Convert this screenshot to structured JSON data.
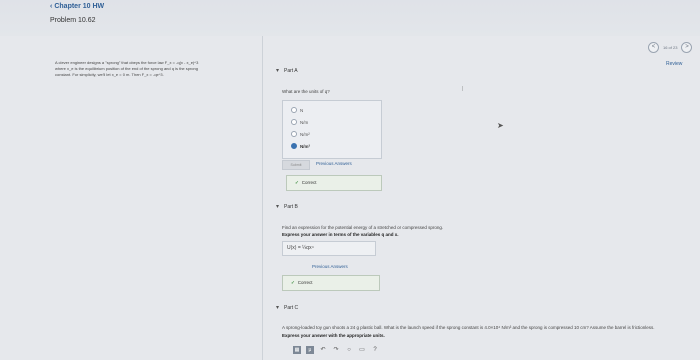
{
  "header": {
    "breadcrumb": "Chapter 10 HW",
    "problem_title": "Problem 10.62"
  },
  "problem": {
    "lines": [
      "A clever engineer designs a \"sprong\" that obeys the force law F_x = -q(x - x_e)^3",
      "where x_e is the equilibrium position of the end of the sprong and q is the sprong",
      "constant. For simplicity, we'll let x_e = 0 m. Then F_x = -qx^3."
    ]
  },
  "pager": {
    "prev": "<",
    "text": "16 of 23",
    "next": ">",
    "review": "Review"
  },
  "part_a": {
    "label": "Part A",
    "question": "What are the units of q?",
    "options": [
      {
        "label": "N",
        "selected": false
      },
      {
        "label": "N/m",
        "selected": false
      },
      {
        "label": "N/m²",
        "selected": false
      },
      {
        "label": "N/m³",
        "selected": true
      }
    ],
    "submit": "Submit",
    "prev_answers": "Previous Answers",
    "status": "Correct"
  },
  "part_b": {
    "label": "Part B",
    "question": "Find an expression for the potential energy of a stretched or compressed sprong.",
    "instruction": "Express your answer in terms of the variables q and x.",
    "answer": "U(x) = ¼qx⁴",
    "prev_answers": "Previous Answers",
    "status": "Correct"
  },
  "part_c": {
    "label": "Part C",
    "question": "A sprong-loaded toy gun shoots a 24 g plastic ball. What is the launch speed if the sprong constant is 4.0×10⁴ N/m³ and the sprong is compressed 10 cm? Assume the barrel is frictionless.",
    "instruction": "Express your answer with the appropriate units."
  },
  "toolbar": {
    "icons": [
      "matrix-icon",
      "mu-icon",
      "undo-icon",
      "redo-icon",
      "reset-icon",
      "keyboard-icon",
      "help-icon"
    ]
  }
}
